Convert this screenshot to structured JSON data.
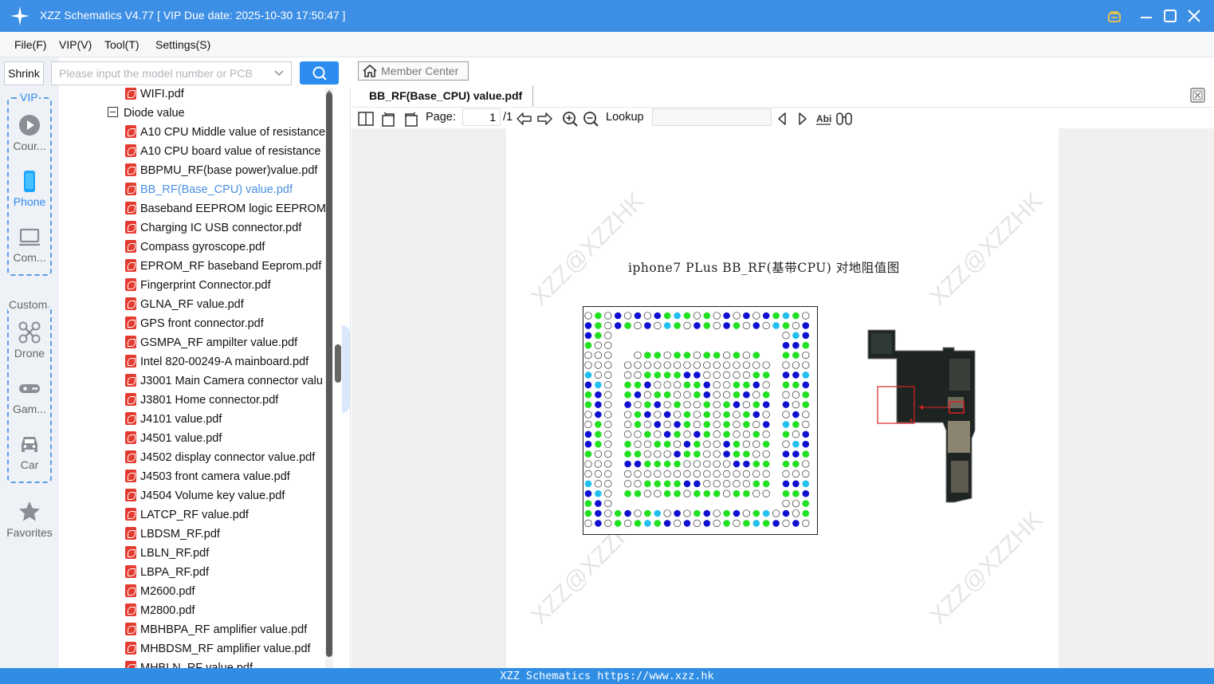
{
  "window": {
    "title": "XZZ Schematics V4.77 [ VIP Due date: 2025-10-30 17:50:47 ]",
    "accent": "#3d8fe6"
  },
  "menu": [
    "File(F)",
    "VIP(V)",
    "Tool(T)",
    "Settings(S)"
  ],
  "search": {
    "shrink_label": "Shrink",
    "placeholder": "Please input the model number or PCB"
  },
  "sidebar": {
    "vip_label": "VIP",
    "custom_label": "Custom",
    "items": [
      {
        "label": "Cour...",
        "icon": "course-icon"
      },
      {
        "label": "Phone",
        "icon": "phone-icon",
        "active": true
      },
      {
        "label": "Com...",
        "icon": "computer-icon"
      },
      {
        "label": "Drone",
        "icon": "drone-icon"
      },
      {
        "label": "Gam...",
        "icon": "gamepad-icon"
      },
      {
        "label": "Car",
        "icon": "car-icon"
      },
      {
        "label": "Favorites",
        "icon": "star-icon"
      }
    ]
  },
  "tree": {
    "top_file": "WIFI.pdf",
    "folder": "Diode value",
    "selected": "BB_RF(Base_CPU) value.pdf",
    "files": [
      "A10 CPU Middle value of resistance",
      "A10 CPU board value of resistance",
      "BBPMU_RF(base power)value.pdf",
      "BB_RF(Base_CPU) value.pdf",
      "Baseband EEPROM logic EEPROM.",
      "Charging IC USB connector.pdf",
      "Compass gyroscope.pdf",
      "EPROM_RF baseband Eeprom.pdf",
      "Fingerprint Connector.pdf",
      "GLNA_RF value.pdf",
      "GPS front connector.pdf",
      "GSMPA_RF ampilter value.pdf",
      "Intel 820-00249-A mainboard.pdf",
      "J3001 Main Camera connector valu",
      "J3801 Home connector.pdf",
      "J4101 value.pdf",
      "J4501 value.pdf",
      "J4502 display connector value.pdf",
      "J4503 front camera value.pdf",
      "J4504 Volume key value.pdf",
      "LATCP_RF value.pdf",
      "LBDSM_RF.pdf",
      "LBLN_RF.pdf",
      "LBPA_RF.pdf",
      "M2600.pdf",
      "M2800.pdf",
      "MBHBPA_RF amplifier value.pdf",
      "MHBDSM_RF amplifier value.pdf",
      "MHBLN_RF value.pdf"
    ]
  },
  "viewer": {
    "member_center": "Member Center",
    "tab": "BB_RF(Base_CPU) value.pdf",
    "page_label": "Page:",
    "page_current": "1",
    "page_total": "/1",
    "lookup_label": "Lookup",
    "doc_title": "iphone7 PLus BB_RF(基带CPU) 对地阻值图",
    "watermark": "XZZ@XZZHK"
  },
  "status": "XZZ Schematics https://www.xzz.hk"
}
